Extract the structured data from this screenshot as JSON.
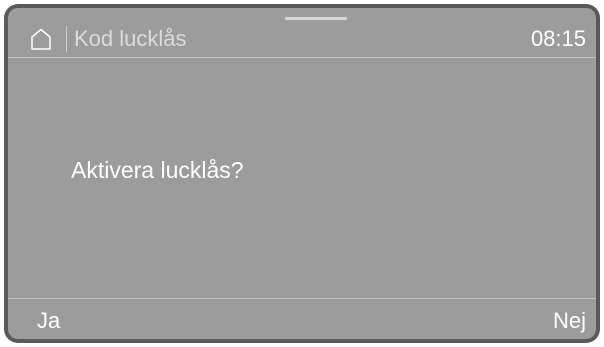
{
  "header": {
    "icon": "home-icon",
    "title": "Kod lucklås",
    "time": "08:15"
  },
  "dialog": {
    "question": "Aktivera lucklås?"
  },
  "footer": {
    "left_label": "Ja",
    "right_label": "Nej"
  }
}
